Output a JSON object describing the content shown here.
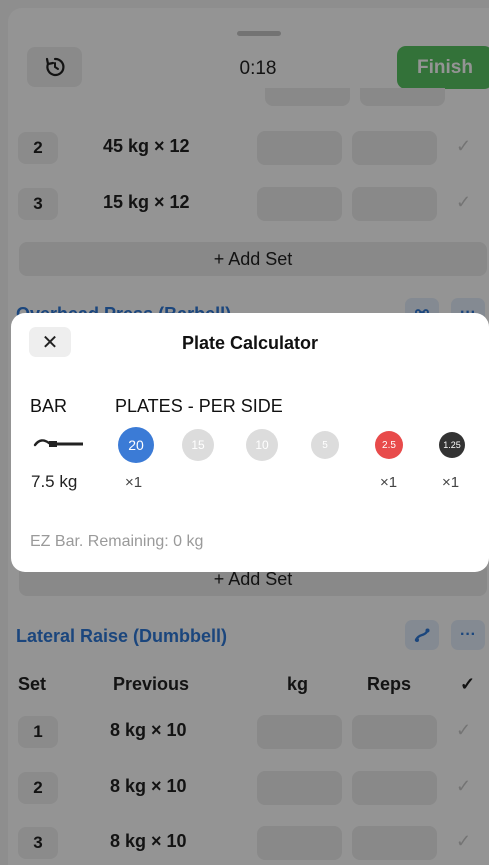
{
  "header": {
    "timer": "0:18",
    "finish_label": "Finish"
  },
  "exercise1": {
    "sets": [
      {
        "number": "2",
        "previous": "45 kg × 12"
      },
      {
        "number": "3",
        "previous": "15 kg × 12"
      }
    ],
    "add_set_label": "+ Add Set"
  },
  "exercise2": {
    "title": "Overhead Press (Barbell)",
    "add_set_label": "+ Add Set"
  },
  "exercise3": {
    "title": "Lateral Raise (Dumbbell)",
    "columns": {
      "set": "Set",
      "previous": "Previous",
      "kg": "kg",
      "reps": "Reps",
      "done": "✓"
    },
    "sets": [
      {
        "number": "1",
        "previous": "8 kg × 10"
      },
      {
        "number": "2",
        "previous": "8 kg × 10"
      },
      {
        "number": "3",
        "previous": "8 kg × 10"
      }
    ],
    "more_label": "···"
  },
  "modal": {
    "close": "✕",
    "title": "Plate Calculator",
    "bar_label": "BAR",
    "plates_label": "PLATES - PER SIDE",
    "bar_weight": "7.5 kg",
    "plates": [
      {
        "value": "20",
        "color": "#3b7bd6",
        "active": true,
        "count": "×1"
      },
      {
        "value": "15",
        "color": "#dcdcdc",
        "active": false,
        "count": ""
      },
      {
        "value": "10",
        "color": "#dcdcdc",
        "active": false,
        "count": ""
      },
      {
        "value": "5",
        "color": "#dcdcdc",
        "active": false,
        "count": ""
      },
      {
        "value": "2.5",
        "color": "#e84b4b",
        "active": true,
        "count": "×1"
      },
      {
        "value": "1.25",
        "color": "#333333",
        "active": true,
        "count": "×1"
      }
    ],
    "remaining": "EZ Bar. Remaining: 0 kg"
  },
  "colors": {
    "accent": "#2f79d8",
    "finish": "#58c463"
  }
}
